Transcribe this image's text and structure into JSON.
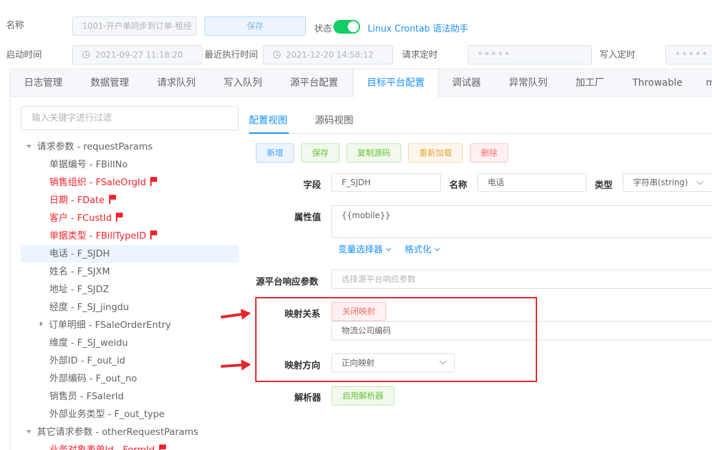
{
  "header": {
    "name_label": "名称",
    "name_value": "1001-开户单同步到订单-租经",
    "save_label": "保存",
    "status_label": "状态",
    "status_on": true,
    "crontab_link": "Linux Crontab 语法助手",
    "start_time_label": "启动时间",
    "start_time_value": "2021-09-27 11:18:20",
    "last_exec_label": "最近执行时间",
    "last_exec_value": "2021-12-20 14:58:12",
    "request_timer_label": "请求定时",
    "request_timer_value": "* * * * *",
    "write_timer_label": "写入定时",
    "write_timer_value": "* * * * *"
  },
  "tabs": [
    "日志管理",
    "数据管理",
    "请求队列",
    "写入队列",
    "源平台配置",
    "目标平台配置",
    "调试器",
    "异常队列",
    "加工厂",
    "Throwable",
    "m"
  ],
  "active_tab": "目标平台配置",
  "tree": {
    "filter_placeholder": "输入关键字进行过滤",
    "items": [
      {
        "label": "请求参数 - requestParams",
        "color": "normal",
        "flag": false,
        "caret": "down",
        "selected": false
      },
      {
        "label": "单据编号 - FBillNo",
        "color": "normal",
        "flag": false,
        "caret": "",
        "selected": false
      },
      {
        "label": "销售组织 - FSaleOrgId",
        "color": "red",
        "flag": true,
        "caret": "",
        "selected": false
      },
      {
        "label": "日期 - FDate",
        "color": "red",
        "flag": true,
        "caret": "",
        "selected": false
      },
      {
        "label": "客户 - FCustId",
        "color": "red",
        "flag": true,
        "caret": "",
        "selected": false
      },
      {
        "label": "单据类型 - FBillTypeID",
        "color": "red",
        "flag": true,
        "caret": "",
        "selected": false
      },
      {
        "label": "电话 - F_SJDH",
        "color": "normal",
        "flag": false,
        "caret": "",
        "selected": true
      },
      {
        "label": "姓名 - F_SJXM",
        "color": "normal",
        "flag": false,
        "caret": "",
        "selected": false
      },
      {
        "label": "地址 - F_SJDZ",
        "color": "normal",
        "flag": false,
        "caret": "",
        "selected": false
      },
      {
        "label": "经度 - F_SJ_jingdu",
        "color": "normal",
        "flag": false,
        "caret": "",
        "selected": false
      },
      {
        "label": "订单明细 - FSaleOrderEntry",
        "color": "normal",
        "flag": false,
        "caret": "right",
        "selected": false
      },
      {
        "label": "维度 - F_SJ_weidu",
        "color": "normal",
        "flag": false,
        "caret": "",
        "selected": false
      },
      {
        "label": "外部ID - F_out_id",
        "color": "normal",
        "flag": false,
        "caret": "",
        "selected": false
      },
      {
        "label": "外部编码 - F_out_no",
        "color": "normal",
        "flag": false,
        "caret": "",
        "selected": false
      },
      {
        "label": "销售员 - FSalerId",
        "color": "normal",
        "flag": false,
        "caret": "",
        "selected": false
      },
      {
        "label": "外部业务类型 - F_out_type",
        "color": "normal",
        "flag": false,
        "caret": "",
        "selected": false
      },
      {
        "label": "其它请求参数 - otherRequestParams",
        "color": "normal",
        "flag": false,
        "caret": "down",
        "selected": false
      },
      {
        "label": "业务对象表单Id - FormId",
        "color": "red",
        "flag": true,
        "caret": "",
        "selected": false
      }
    ]
  },
  "subtabs": [
    "配置视图",
    "源码视图"
  ],
  "actions": {
    "add": "新增",
    "save": "保存",
    "copy": "复制源码",
    "reload": "重新加载",
    "delete": "删除"
  },
  "form": {
    "field_label": "字段",
    "field_value": "F_SJDH",
    "name_label": "名称",
    "name_value": "电话",
    "type_label": "类型",
    "type_value": "字符串(string)",
    "attr_label": "属性值",
    "attr_value": "{{mobile}}",
    "var_selector": "变量选择器",
    "format": "格式化",
    "src_param_label": "源平台响应参数",
    "src_param_placeholder": "选择源平台响应参数",
    "mapping_label": "映射关系",
    "mapping_button": "关闭映射",
    "mapping_value": "物流公司编码",
    "direction_label": "映射方向",
    "direction_value": "正向映射",
    "parser_label": "解析器",
    "parser_button": "启用解析器"
  },
  "colors": {
    "accent": "#1890ff",
    "success": "#13ce66",
    "highlight": "#e4242b",
    "required": "#f5222d"
  }
}
